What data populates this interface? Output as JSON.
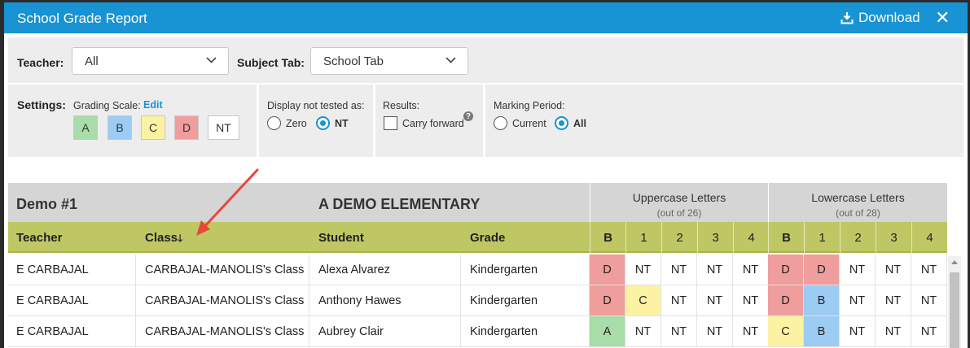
{
  "window": {
    "title": "School Grade Report",
    "download_label": "Download",
    "close_label": "✕"
  },
  "filters": {
    "teacher_label": "Teacher:",
    "teacher_value": "All",
    "subject_label": "Subject Tab:",
    "subject_value": "School Tab"
  },
  "settings": {
    "settings_label": "Settings:",
    "grading_scale_label": "Grading Scale:",
    "edit_label": "Edit",
    "scale": [
      {
        "label": "A",
        "color": "#a8dca8"
      },
      {
        "label": "B",
        "color": "#9ccbf3"
      },
      {
        "label": "C",
        "color": "#fbf3a3"
      },
      {
        "label": "D",
        "color": "#ef9d9d"
      },
      {
        "label": "NT",
        "color": "#ffffff"
      }
    ],
    "display_label": "Display not tested as:",
    "zero_label": "Zero",
    "nt_label": "NT",
    "results_label": "Results:",
    "carry_label": "Carry forward",
    "help_icon": "?",
    "marking_label": "Marking Period:",
    "current_label": "Current",
    "all_label": "All"
  },
  "report": {
    "name": "Demo #1",
    "school": "A DEMO ELEMENTARY",
    "groups": [
      {
        "title": "Uppercase Letters",
        "sub": "(out of 26)"
      },
      {
        "title": "Lowercase Letters",
        "sub": "(out of 28)"
      }
    ],
    "columns": {
      "teacher": "Teacher",
      "class": "Class",
      "sort_icon": "🡓",
      "student": "Student",
      "grade": "Grade"
    },
    "score_columns": [
      "B",
      "1",
      "2",
      "3",
      "4",
      "B",
      "1",
      "2",
      "3",
      "4"
    ],
    "rows": [
      {
        "teacher": "E CARBAJAL",
        "class": "CARBAJAL-MANOLIS's Class",
        "student": "Alexa Alvarez",
        "grade": "Kindergarten",
        "scores": [
          "D",
          "NT",
          "NT",
          "NT",
          "NT",
          "D",
          "D",
          "NT",
          "NT",
          "NT"
        ]
      },
      {
        "teacher": "E CARBAJAL",
        "class": "CARBAJAL-MANOLIS's Class",
        "student": "Anthony Hawes",
        "grade": "Kindergarten",
        "scores": [
          "D",
          "C",
          "NT",
          "NT",
          "NT",
          "D",
          "B",
          "NT",
          "NT",
          "NT"
        ]
      },
      {
        "teacher": "E CARBAJAL",
        "class": "CARBAJAL-MANOLIS's Class",
        "student": "Aubrey Clair",
        "grade": "Kindergarten",
        "scores": [
          "A",
          "NT",
          "NT",
          "NT",
          "NT",
          "C",
          "B",
          "NT",
          "NT",
          "NT"
        ]
      }
    ]
  }
}
